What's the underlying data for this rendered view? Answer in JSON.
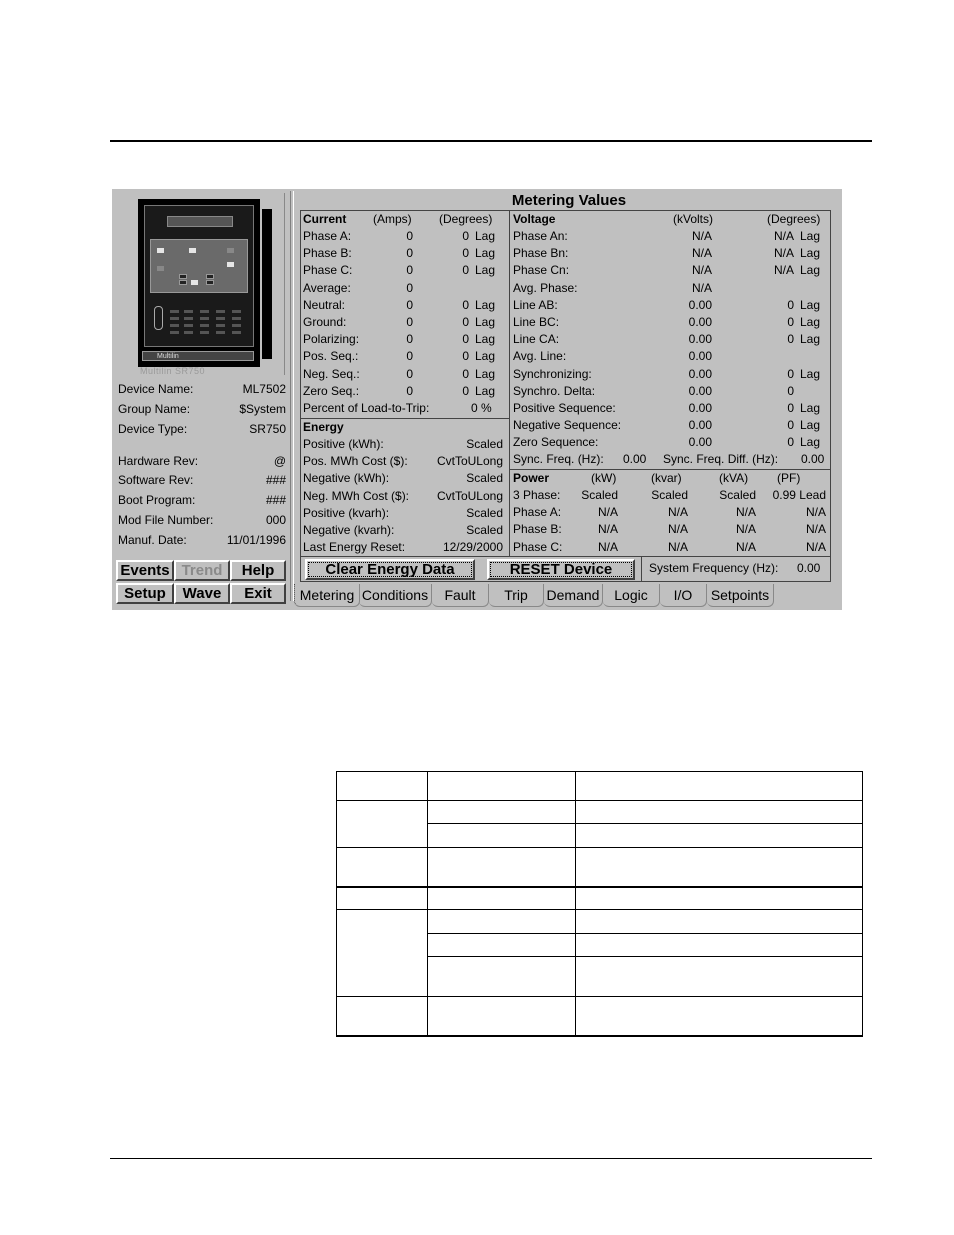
{
  "app": {
    "title": "Metering Values",
    "device_image_caption": "Multilin SR750",
    "device_brand": "Multilin",
    "device_info": [
      {
        "label": "Device Name:",
        "value": "ML7502"
      },
      {
        "label": "Group Name:",
        "value": "$System"
      },
      {
        "label": "Device Type:",
        "value": "SR750"
      },
      {
        "label": "Hardware Rev:",
        "value": "@"
      },
      {
        "label": "Software Rev:",
        "value": "###"
      },
      {
        "label": "Boot Program:",
        "value": "###"
      },
      {
        "label": "Mod File Number:",
        "value": "000"
      },
      {
        "label": "Manuf. Date:",
        "value": "11/01/1996"
      }
    ],
    "buttons": {
      "events": "Events",
      "trend": "Trend",
      "help": "Help",
      "setup": "Setup",
      "wave": "Wave",
      "exit": "Exit"
    },
    "current": {
      "heading": "Current",
      "unit1": "(Amps)",
      "unit2": "(Degrees)",
      "rows": [
        {
          "label": "Phase A:",
          "amps": "0",
          "deg": "0",
          "dir": "Lag"
        },
        {
          "label": "Phase B:",
          "amps": "0",
          "deg": "0",
          "dir": "Lag"
        },
        {
          "label": "Phase C:",
          "amps": "0",
          "deg": "0",
          "dir": "Lag"
        },
        {
          "label": "Average:",
          "amps": "0",
          "deg": "",
          "dir": ""
        },
        {
          "label": "Neutral:",
          "amps": "0",
          "deg": "0",
          "dir": "Lag"
        },
        {
          "label": "Ground:",
          "amps": "0",
          "deg": "0",
          "dir": "Lag"
        },
        {
          "label": "Polarizing:",
          "amps": "0",
          "deg": "0",
          "dir": "Lag"
        },
        {
          "label": "Pos. Seq.:",
          "amps": "0",
          "deg": "0",
          "dir": "Lag"
        },
        {
          "label": "Neg. Seq.:",
          "amps": "0",
          "deg": "0",
          "dir": "Lag"
        },
        {
          "label": "Zero Seq.:",
          "amps": "0",
          "deg": "0",
          "dir": "Lag"
        }
      ],
      "load_to_trip_label": "Percent of Load-to-Trip:",
      "load_to_trip_value": "0 %"
    },
    "energy": {
      "heading": "Energy",
      "rows": [
        {
          "label": "Positive (kWh):",
          "value": "Scaled"
        },
        {
          "label": "Pos. MWh Cost ($):",
          "value": "CvtToULong"
        },
        {
          "label": "Negative (kWh):",
          "value": "Scaled"
        },
        {
          "label": "Neg. MWh Cost ($):",
          "value": "CvtToULong"
        },
        {
          "label": "Positive (kvarh):",
          "value": "Scaled"
        },
        {
          "label": "Negative (kvarh):",
          "value": "Scaled"
        },
        {
          "label": "Last Energy Reset:",
          "value": "12/29/2000"
        }
      ]
    },
    "voltage": {
      "heading": "Voltage",
      "unit1": "(kVolts)",
      "unit2": "(Degrees)",
      "rows": [
        {
          "label": "Phase An:",
          "kv": "N/A",
          "deg": "N/A",
          "dir": "Lag"
        },
        {
          "label": "Phase Bn:",
          "kv": "N/A",
          "deg": "N/A",
          "dir": "Lag"
        },
        {
          "label": "Phase Cn:",
          "kv": "N/A",
          "deg": "N/A",
          "dir": "Lag"
        },
        {
          "label": "Avg. Phase:",
          "kv": "N/A",
          "deg": "",
          "dir": ""
        },
        {
          "label": "Line AB:",
          "kv": "0.00",
          "deg": "0",
          "dir": "Lag"
        },
        {
          "label": "Line BC:",
          "kv": "0.00",
          "deg": "0",
          "dir": "Lag"
        },
        {
          "label": "Line CA:",
          "kv": "0.00",
          "deg": "0",
          "dir": "Lag"
        },
        {
          "label": "Avg. Line:",
          "kv": "0.00",
          "deg": "",
          "dir": ""
        },
        {
          "label": "Synchronizing:",
          "kv": "0.00",
          "deg": "0",
          "dir": "Lag"
        },
        {
          "label": "Synchro. Delta:",
          "kv": "0.00",
          "deg": "0",
          "dir": ""
        },
        {
          "label": "Positive Sequence:",
          "kv": "0.00",
          "deg": "0",
          "dir": "Lag"
        },
        {
          "label": "Negative Sequence:",
          "kv": "0.00",
          "deg": "0",
          "dir": "Lag"
        },
        {
          "label": "Zero Sequence:",
          "kv": "0.00",
          "deg": "0",
          "dir": "Lag"
        }
      ],
      "sync_freq_label": "Sync. Freq. (Hz):",
      "sync_freq_value": "0.00",
      "sync_freq_diff_label": "Sync. Freq. Diff. (Hz):",
      "sync_freq_diff_value": "0.00"
    },
    "power": {
      "heading": "Power",
      "headers": [
        "(kW)",
        "(kvar)",
        "(kVA)",
        "(PF)"
      ],
      "rows": [
        {
          "label": "3 Phase:",
          "kw": "Scaled",
          "kvar": "Scaled",
          "kva": "Scaled",
          "pf": "0.99 Lead"
        },
        {
          "label": "Phase A:",
          "kw": "N/A",
          "kvar": "N/A",
          "kva": "N/A",
          "pf": "N/A"
        },
        {
          "label": "Phase B:",
          "kw": "N/A",
          "kvar": "N/A",
          "kva": "N/A",
          "pf": "N/A"
        },
        {
          "label": "Phase C:",
          "kw": "N/A",
          "kvar": "N/A",
          "kva": "N/A",
          "pf": "N/A"
        }
      ]
    },
    "actions": {
      "clear_energy": "Clear Energy Data",
      "reset_device": "RESET Device"
    },
    "system_frequency_label": "System Frequency (Hz):",
    "system_frequency_value": "0.00",
    "tabs": [
      "Metering",
      "Conditions",
      "Fault",
      "Trip",
      "Demand",
      "Logic",
      "I/O",
      "Setpoints"
    ],
    "active_tab": "Metering"
  },
  "doc_table": {
    "rows": 10,
    "columns": 3
  }
}
